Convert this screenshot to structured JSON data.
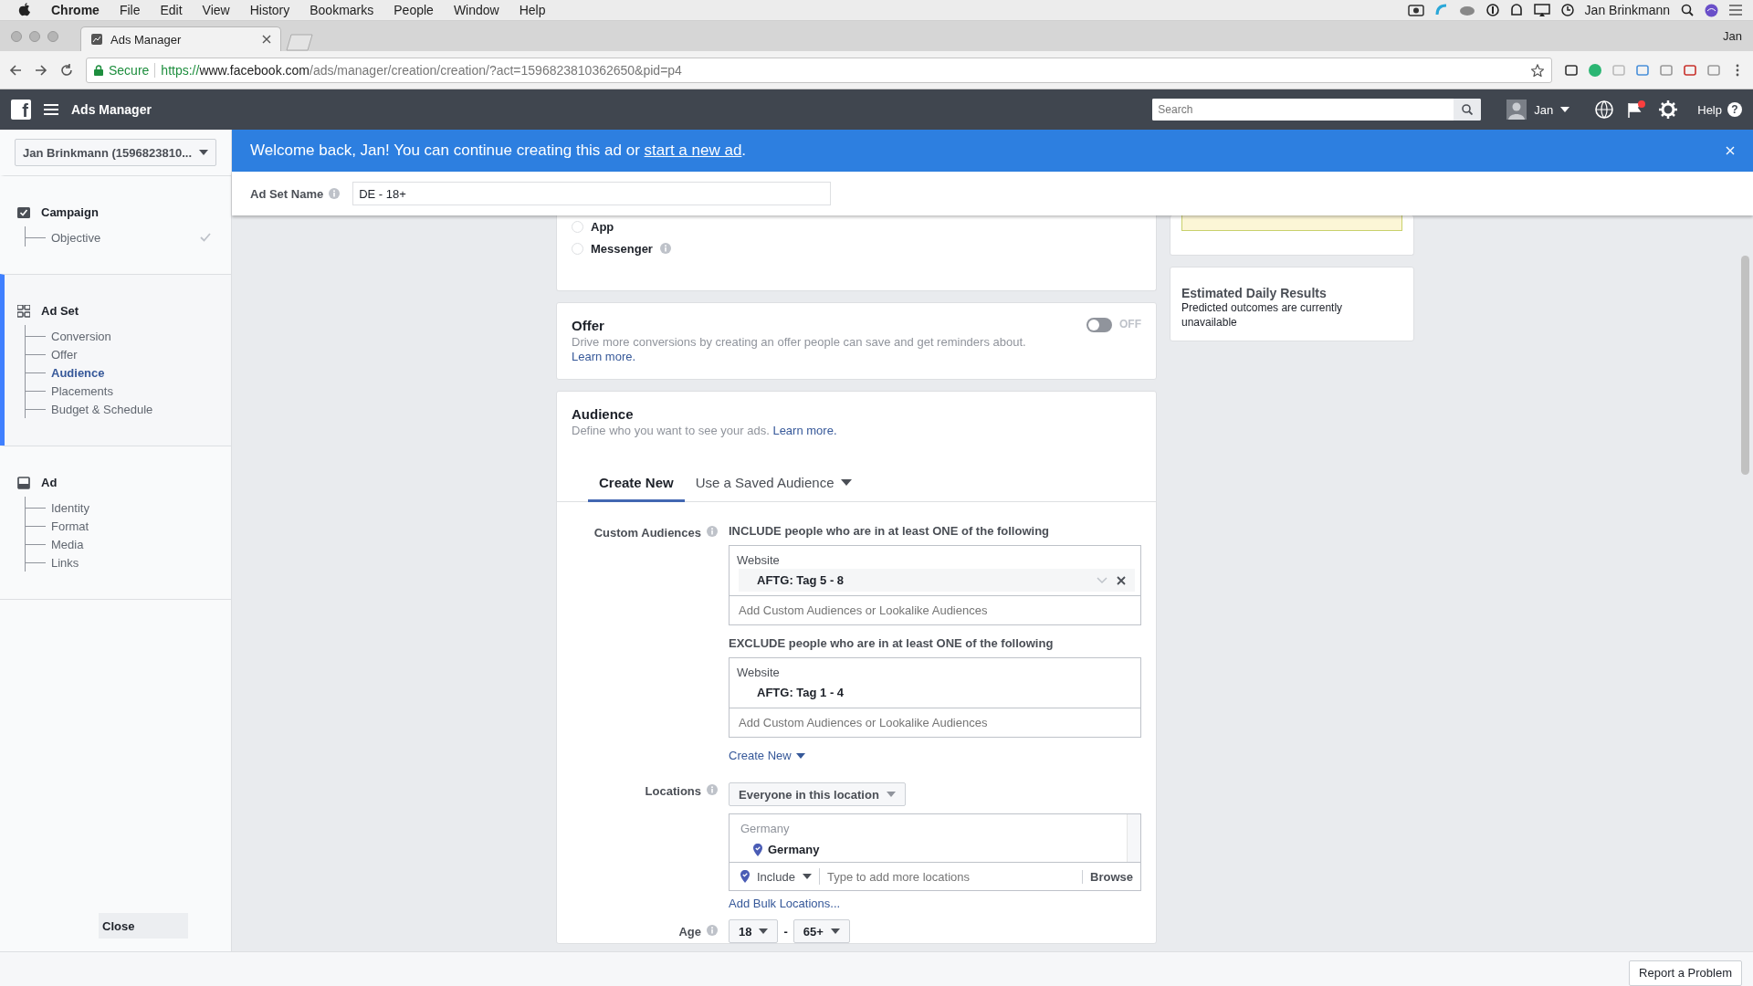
{
  "menubar": {
    "app": "Chrome",
    "menus": [
      "File",
      "Edit",
      "View",
      "History",
      "Bookmarks",
      "People",
      "Window",
      "Help"
    ],
    "user": "Jan Brinkmann"
  },
  "browser": {
    "tabs": [
      {
        "title": "Ads Manager",
        "selected": true
      }
    ],
    "profile": "Jan",
    "url": {
      "secure_label": "Secure",
      "scheme": "https://",
      "host": "www.facebook.com",
      "path": "/ads/manager/creation/creation/?act=1596823810362650&pid=p4"
    }
  },
  "header": {
    "logo": "f",
    "title": "Ads Manager",
    "search_placeholder": "Search",
    "user": "Jan",
    "help": "Help",
    "help_glyph": "?",
    "notification": true
  },
  "sidebar": {
    "account": "Jan Brinkmann (1596823810...",
    "sections": [
      {
        "title": "Campaign",
        "kind": "campaign",
        "active": false,
        "items": [
          {
            "label": "Objective",
            "selected": false,
            "done": true
          }
        ]
      },
      {
        "title": "Ad Set",
        "kind": "adset",
        "active": true,
        "items": [
          {
            "label": "Conversion",
            "selected": false,
            "done": false
          },
          {
            "label": "Offer",
            "selected": false,
            "done": false
          },
          {
            "label": "Audience",
            "selected": true,
            "done": false
          },
          {
            "label": "Placements",
            "selected": false,
            "done": false
          },
          {
            "label": "Budget & Schedule",
            "selected": false,
            "done": false
          }
        ]
      },
      {
        "title": "Ad",
        "kind": "ad",
        "active": false,
        "items": [
          {
            "label": "Identity",
            "selected": false,
            "done": false
          },
          {
            "label": "Format",
            "selected": false,
            "done": false
          },
          {
            "label": "Media",
            "selected": false,
            "done": false
          },
          {
            "label": "Links",
            "selected": false,
            "done": false
          }
        ]
      }
    ],
    "close": "Close"
  },
  "banner": {
    "text": "Welcome back, Jan! You can continue creating this ad or ",
    "link": "start a new ad",
    "tail": "."
  },
  "ad_set_name": {
    "label": "Ad Set Name",
    "value": "DE - 18+"
  },
  "placement_options": [
    {
      "label": "App",
      "selected": false,
      "info": false
    },
    {
      "label": "Messenger",
      "selected": false,
      "info": true
    }
  ],
  "offer": {
    "title": "Offer",
    "description": "Drive more conversions by creating an offer people can save and get reminders about.",
    "link": "Learn more.",
    "on": false,
    "state_label": "OFF"
  },
  "audience": {
    "title": "Audience",
    "description": "Define who you want to see your ads.",
    "link": "Learn more.",
    "tabs": [
      {
        "label": "Create New",
        "selected": true,
        "dropdown": false
      },
      {
        "label": "Use a Saved Audience",
        "selected": false,
        "dropdown": true
      }
    ],
    "custom_audiences": {
      "label": "Custom Audiences",
      "lists": [
        {
          "heading": "INCLUDE people who are in at least ONE of the following",
          "group": "Website",
          "items": [
            {
              "label": "AFTG: Tag 5 - 8",
              "hovered": true
            }
          ],
          "placeholder": "Add Custom Audiences or Lookalike Audiences"
        },
        {
          "heading": "EXCLUDE people who are in at least ONE of the following",
          "group": "Website",
          "items": [
            {
              "label": "AFTG: Tag 1 - 4",
              "hovered": false
            }
          ],
          "placeholder": "Add Custom Audiences or Lookalike Audiences"
        }
      ],
      "create_new": "Create New"
    },
    "locations": {
      "label": "Locations",
      "mode": "Everyone in this location",
      "group": "Germany",
      "items": [
        "Germany"
      ],
      "include": "Include",
      "placeholder": "Type to add more locations",
      "browse": "Browse",
      "bulk": "Add Bulk Locations..."
    },
    "age": {
      "label": "Age",
      "min": "18",
      "separator": "-",
      "max": "65+"
    }
  },
  "estimate": {
    "title": "Estimated Daily Results",
    "text": "Predicted outcomes are currently unavailable"
  },
  "footer": {
    "report": "Report a Problem"
  }
}
